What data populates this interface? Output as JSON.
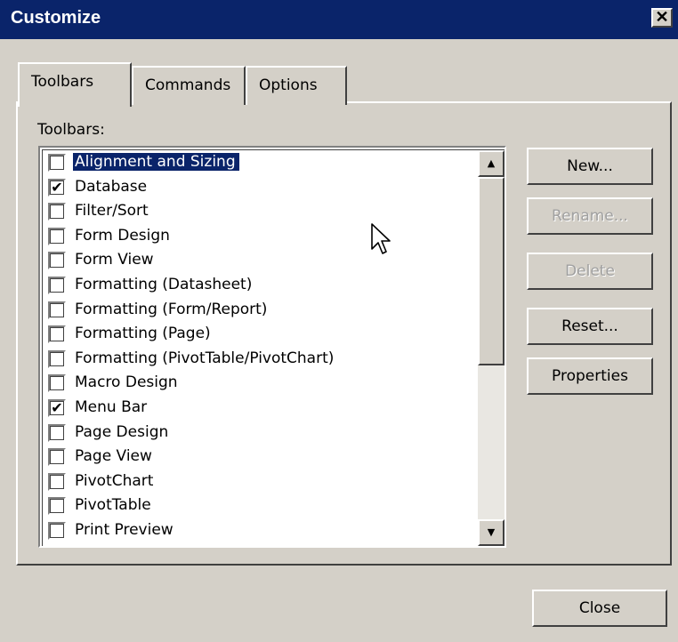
{
  "window": {
    "title": "Customize",
    "close_glyph": "✕"
  },
  "tabs": [
    {
      "label": "Toolbars",
      "active": true
    },
    {
      "label": "Commands",
      "active": false
    },
    {
      "label": "Options",
      "active": false
    }
  ],
  "toolbars_label": "Toolbars:",
  "toolbars": [
    {
      "label": "Alignment and Sizing",
      "checked": false,
      "selected": true
    },
    {
      "label": "Database",
      "checked": true,
      "selected": false
    },
    {
      "label": "Filter/Sort",
      "checked": false,
      "selected": false
    },
    {
      "label": "Form Design",
      "checked": false,
      "selected": false
    },
    {
      "label": "Form View",
      "checked": false,
      "selected": false
    },
    {
      "label": "Formatting (Datasheet)",
      "checked": false,
      "selected": false
    },
    {
      "label": "Formatting (Form/Report)",
      "checked": false,
      "selected": false
    },
    {
      "label": "Formatting (Page)",
      "checked": false,
      "selected": false
    },
    {
      "label": "Formatting (PivotTable/PivotChart)",
      "checked": false,
      "selected": false
    },
    {
      "label": "Macro Design",
      "checked": false,
      "selected": false
    },
    {
      "label": "Menu Bar",
      "checked": true,
      "selected": false
    },
    {
      "label": "Page Design",
      "checked": false,
      "selected": false
    },
    {
      "label": "Page View",
      "checked": false,
      "selected": false
    },
    {
      "label": "PivotChart",
      "checked": false,
      "selected": false
    },
    {
      "label": "PivotTable",
      "checked": false,
      "selected": false
    },
    {
      "label": "Print Preview",
      "checked": false,
      "selected": false
    }
  ],
  "buttons": {
    "new": "New...",
    "rename": "Rename...",
    "delete": "Delete",
    "reset": "Reset...",
    "properties": "Properties",
    "close": "Close"
  },
  "colors": {
    "titlebar": "#0a246a",
    "face": "#d4d0c8",
    "selection": "#0a246a"
  }
}
